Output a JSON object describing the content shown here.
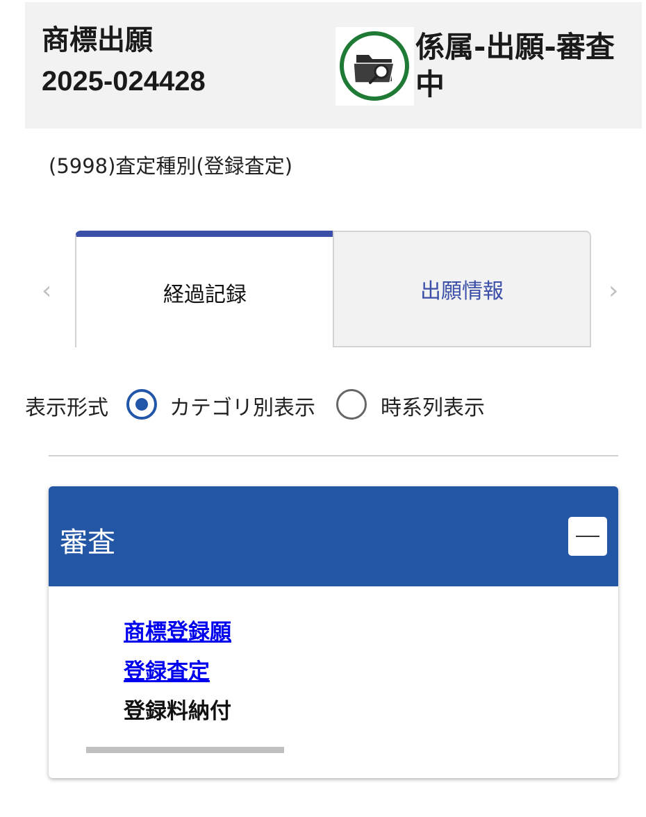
{
  "header": {
    "type_label": "商標出願",
    "application_number": "2025-024428",
    "status_icon": "folder-search-icon",
    "status_text": "係属-出願-審査中"
  },
  "subtitle": "(5998)査定種別(登録査定)",
  "tabs": [
    {
      "label": "経過記録",
      "active": true
    },
    {
      "label": "出願情報",
      "active": false
    }
  ],
  "display_mode": {
    "label": "表示形式",
    "options": [
      {
        "label": "カテゴリ別表示",
        "selected": true
      },
      {
        "label": "時系列表示",
        "selected": false
      }
    ]
  },
  "panel": {
    "title": "審査",
    "items": [
      {
        "label": "商標登録願",
        "link": true
      },
      {
        "label": "登録査定",
        "link": true
      },
      {
        "label": "登録料納付",
        "link": false
      }
    ]
  },
  "colors": {
    "accent": "#2356a4",
    "tab_indicator": "#3b4fa8",
    "status_ring": "#1e7a34",
    "link": "#0000ee"
  }
}
